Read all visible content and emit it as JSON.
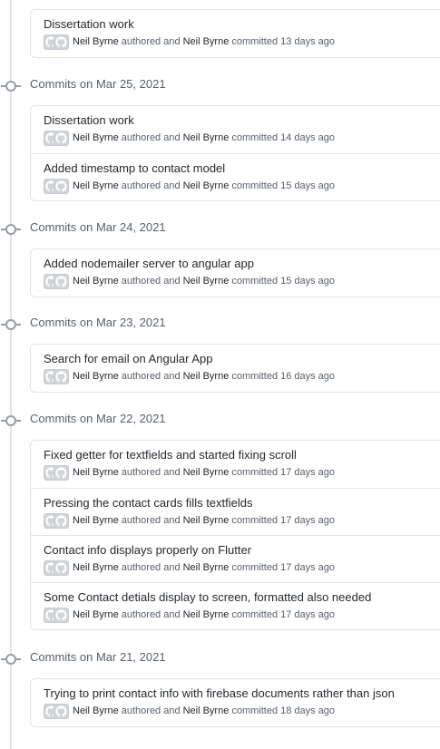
{
  "groups": [
    {
      "date_label": "",
      "commits": [
        {
          "title": "Dissertation work",
          "author": "Neil Byrne",
          "committer": "Neil Byrne",
          "authored_text": "authored and",
          "committed_text": "committed",
          "age": "13 days ago",
          "avatar_icon": "github-octocat-icon"
        }
      ]
    },
    {
      "date_label": "Commits on Mar 25, 2021",
      "commits": [
        {
          "title": "Dissertation work",
          "author": "Neil Byrne",
          "committer": "Neil Byrne",
          "authored_text": "authored and",
          "committed_text": "committed",
          "age": "14 days ago",
          "avatar_icon": "github-octocat-icon"
        },
        {
          "title": "Added timestamp to contact model",
          "author": "Neil Byrne",
          "committer": "Neil Byrne",
          "authored_text": "authored and",
          "committed_text": "committed",
          "age": "15 days ago",
          "avatar_icon": "github-octocat-icon"
        }
      ]
    },
    {
      "date_label": "Commits on Mar 24, 2021",
      "commits": [
        {
          "title": "Added nodemailer server to angular app",
          "author": "Neil Byrne",
          "committer": "Neil Byrne",
          "authored_text": "authored and",
          "committed_text": "committed",
          "age": "15 days ago",
          "avatar_icon": "github-octocat-icon"
        }
      ]
    },
    {
      "date_label": "Commits on Mar 23, 2021",
      "commits": [
        {
          "title": "Search for email on Angular App",
          "author": "Neil Byrne",
          "committer": "Neil Byrne",
          "authored_text": "authored and",
          "committed_text": "committed",
          "age": "16 days ago",
          "avatar_icon": "github-octocat-icon"
        }
      ]
    },
    {
      "date_label": "Commits on Mar 22, 2021",
      "commits": [
        {
          "title": "Fixed getter for textfields and started fixing scroll",
          "author": "Neil Byrne",
          "committer": "Neil Byrne",
          "authored_text": "authored and",
          "committed_text": "committed",
          "age": "17 days ago",
          "avatar_icon": "github-octocat-icon"
        },
        {
          "title": "Pressing the contact cards fills textfields",
          "author": "Neil Byrne",
          "committer": "Neil Byrne",
          "authored_text": "authored and",
          "committed_text": "committed",
          "age": "17 days ago",
          "avatar_icon": "github-octocat-icon"
        },
        {
          "title": "Contact info displays properly on Flutter",
          "author": "Neil Byrne",
          "committer": "Neil Byrne",
          "authored_text": "authored and",
          "committed_text": "committed",
          "age": "17 days ago",
          "avatar_icon": "github-octocat-icon"
        },
        {
          "title": "Some Contact detials display to screen, formatted also needed",
          "author": "Neil Byrne",
          "committer": "Neil Byrne",
          "authored_text": "authored and",
          "committed_text": "committed",
          "age": "17 days ago",
          "avatar_icon": "github-octocat-icon"
        }
      ]
    },
    {
      "date_label": "Commits on Mar 21, 2021",
      "commits": [
        {
          "title": "Trying to print contact info with firebase documents rather than json",
          "author": "Neil Byrne",
          "committer": "Neil Byrne",
          "authored_text": "authored and",
          "committed_text": "committed",
          "age": "18 days ago",
          "avatar_icon": "github-octocat-icon"
        }
      ]
    }
  ],
  "colors": {
    "border": "#e1e4e8",
    "timeline": "#e1e4e8",
    "muted_text": "#586069",
    "primary_text": "#24292e"
  }
}
